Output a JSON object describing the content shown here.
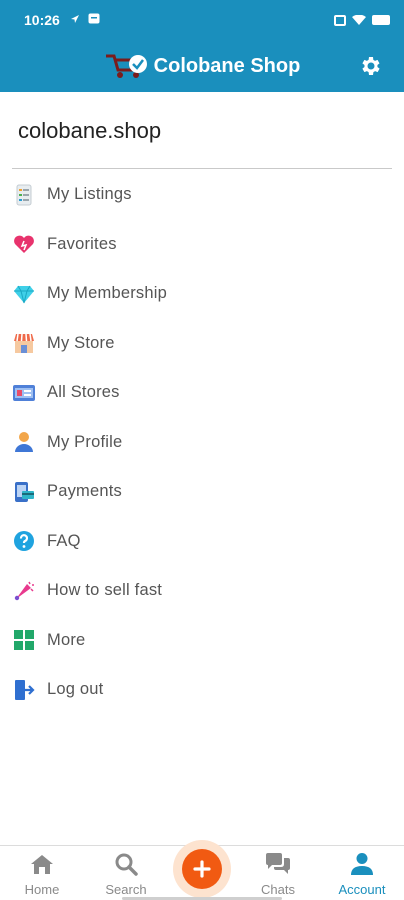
{
  "status_bar": {
    "time": "10:26"
  },
  "app_bar": {
    "title": "Colobane Shop"
  },
  "site_title": "colobane.shop",
  "menu": {
    "items": [
      {
        "label": "My Listings",
        "icon": "listings-icon"
      },
      {
        "label": "Favorites",
        "icon": "heart-icon"
      },
      {
        "label": "My Membership",
        "icon": "diamond-icon"
      },
      {
        "label": "My Store",
        "icon": "store-icon"
      },
      {
        "label": "All Stores",
        "icon": "stores-icon"
      },
      {
        "label": "My Profile",
        "icon": "profile-icon"
      },
      {
        "label": "Payments",
        "icon": "payment-icon"
      },
      {
        "label": "FAQ",
        "icon": "question-icon"
      },
      {
        "label": "How to sell fast",
        "icon": "megaphone-icon"
      },
      {
        "label": "More",
        "icon": "grid-icon"
      },
      {
        "label": "Log out",
        "icon": "logout-icon"
      }
    ]
  },
  "bottom_nav": {
    "home": "Home",
    "search": "Search",
    "chats": "Chats",
    "account": "Account"
  },
  "colors": {
    "primary": "#1a8fbd",
    "accent": "#f15a12"
  }
}
